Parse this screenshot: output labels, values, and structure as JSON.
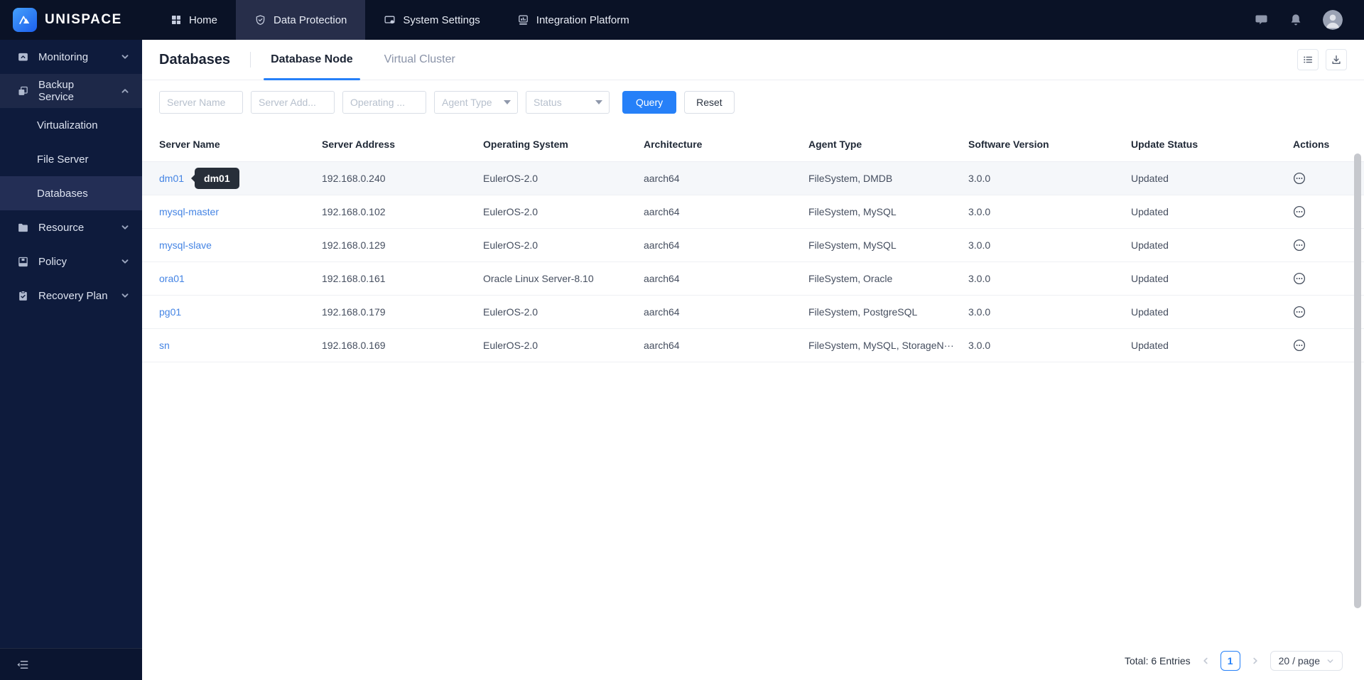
{
  "brand": {
    "name": "UNISPACE"
  },
  "topbar": {
    "tabs": [
      {
        "label": "Home",
        "icon": "home-grid-icon"
      },
      {
        "label": "Data Protection",
        "icon": "shield-icon"
      },
      {
        "label": "System Settings",
        "icon": "monitor-icon"
      },
      {
        "label": "Integration Platform",
        "icon": "chart-box-icon"
      }
    ],
    "right_icons": [
      "chat-icon",
      "bell-icon",
      "avatar"
    ]
  },
  "sidebar": {
    "items": [
      {
        "label": "Monitoring",
        "icon": "monitor-chat-icon",
        "chevron": "down"
      },
      {
        "label": "Backup Service",
        "icon": "copy-icon",
        "chevron": "up"
      },
      {
        "label": "Virtualization"
      },
      {
        "label": "File Server"
      },
      {
        "label": "Databases"
      },
      {
        "label": "Resource",
        "icon": "folder-icon",
        "chevron": "down"
      },
      {
        "label": "Policy",
        "icon": "archive-icon",
        "chevron": "down"
      },
      {
        "label": "Recovery Plan",
        "icon": "clipboard-check-icon",
        "chevron": "down"
      }
    ]
  },
  "page": {
    "title": "Databases",
    "tabs": [
      {
        "label": "Database Node",
        "active": true
      },
      {
        "label": "Virtual Cluster",
        "active": false
      }
    ]
  },
  "filters": {
    "inputs": [
      {
        "placeholder": "Server Name"
      },
      {
        "placeholder": "Server Add..."
      },
      {
        "placeholder": "Operating ..."
      }
    ],
    "selects": [
      {
        "placeholder": "Agent Type"
      },
      {
        "placeholder": "Status"
      }
    ],
    "query_label": "Query",
    "reset_label": "Reset"
  },
  "table": {
    "columns": [
      "Server Name",
      "Server Address",
      "Operating System",
      "Architecture",
      "Agent Type",
      "Software Version",
      "Update Status",
      "Actions"
    ],
    "tooltip": "dm01",
    "rows": [
      {
        "name": "dm01",
        "address": "192.168.0.240",
        "os": "EulerOS-2.0",
        "arch": "aarch64",
        "agent": "FileSystem, DMDB",
        "version": "3.0.0",
        "status": "Updated"
      },
      {
        "name": "mysql-master",
        "address": "192.168.0.102",
        "os": "EulerOS-2.0",
        "arch": "aarch64",
        "agent": "FileSystem, MySQL",
        "version": "3.0.0",
        "status": "Updated"
      },
      {
        "name": "mysql-slave",
        "address": "192.168.0.129",
        "os": "EulerOS-2.0",
        "arch": "aarch64",
        "agent": "FileSystem, MySQL",
        "version": "3.0.0",
        "status": "Updated"
      },
      {
        "name": "ora01",
        "address": "192.168.0.161",
        "os": "Oracle Linux Server-8.10",
        "arch": "aarch64",
        "agent": "FileSystem, Oracle",
        "version": "3.0.0",
        "status": "Updated"
      },
      {
        "name": "pg01",
        "address": "192.168.0.179",
        "os": "EulerOS-2.0",
        "arch": "aarch64",
        "agent": "FileSystem, PostgreSQL",
        "version": "3.0.0",
        "status": "Updated"
      },
      {
        "name": "sn",
        "address": "192.168.0.169",
        "os": "EulerOS-2.0",
        "arch": "aarch64",
        "agent": "FileSystem, MySQL, StorageN···",
        "version": "3.0.0",
        "status": "Updated"
      }
    ]
  },
  "pagination": {
    "total": "Total: 6 Entries",
    "page": "1",
    "page_size": "20 / page"
  },
  "colors": {
    "accent": "#2680f8",
    "link": "#4484e4",
    "topbar_bg": "#0a1226",
    "sidebar_bg": "#0e1b3c",
    "tooltip_bg": "#272e39"
  }
}
